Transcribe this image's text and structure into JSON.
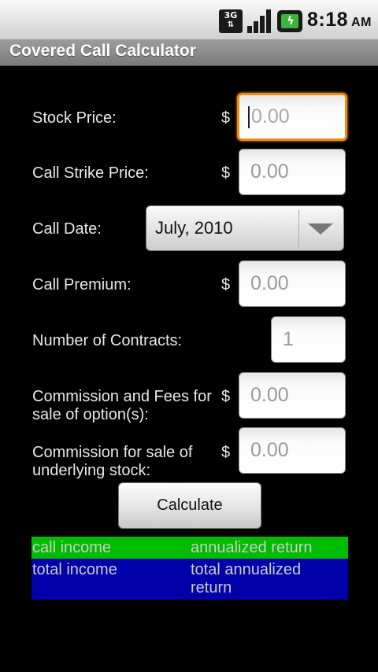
{
  "status_bar": {
    "network": "3G",
    "time": "8:18",
    "ampm": "AM"
  },
  "app": {
    "title": "Covered Call Calculator"
  },
  "form": {
    "currency_symbol": "$",
    "stock_price": {
      "label": "Stock Price:",
      "placeholder": "0.00"
    },
    "call_strike_price": {
      "label": "Call Strike Price:",
      "placeholder": "0.00"
    },
    "call_date": {
      "label": "Call Date:",
      "selected": "July, 2010"
    },
    "call_premium": {
      "label": "Call Premium:",
      "placeholder": "0.00"
    },
    "contracts": {
      "label": "Number of Contracts:",
      "placeholder": "1"
    },
    "commission_option": {
      "label_line1": "Commission and Fees for",
      "label_line2": "sale of option(s):",
      "placeholder": "0.00"
    },
    "commission_stock": {
      "label_line1": "Commission for sale of",
      "label_line2": "underlying stock:",
      "placeholder": "0.00"
    },
    "calculate_label": "Calculate"
  },
  "results": {
    "call_income": "call income",
    "annualized_return": "annualized return",
    "total_income": "total income",
    "total_annualized_line1": "total annualized",
    "total_annualized_line2": "return",
    "colors": {
      "green": "#00bb00",
      "blue": "#0000aa"
    }
  }
}
